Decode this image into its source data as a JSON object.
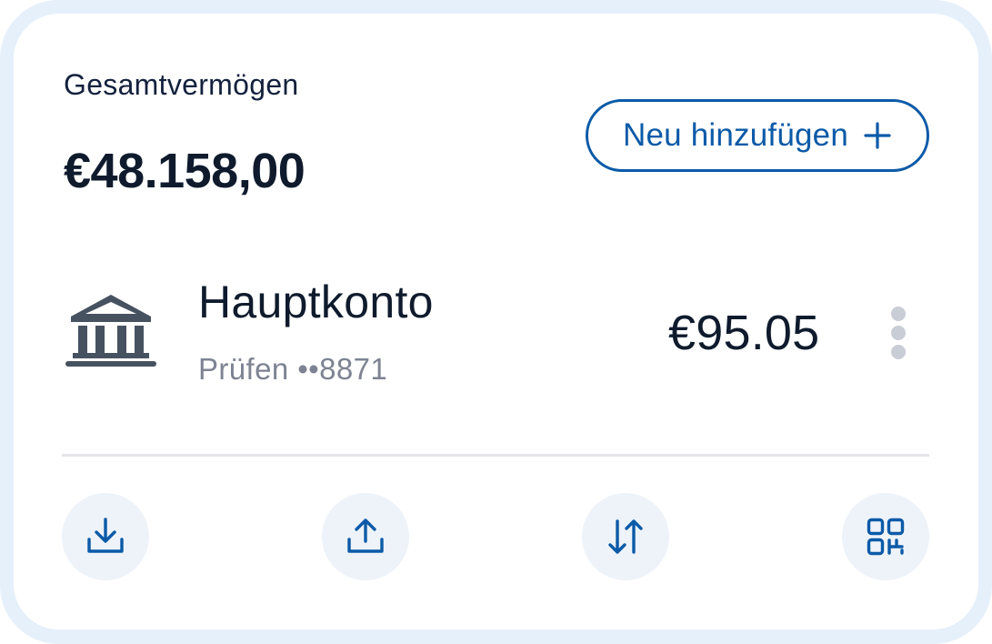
{
  "summary": {
    "total_label": "Gesamtvermögen",
    "total_value": "€48.158,00"
  },
  "add_button": {
    "label": "Neu hinzufügen",
    "icon": "plus-icon"
  },
  "account": {
    "icon": "bank-icon",
    "name": "Hauptkonto",
    "subtitle": "Prüfen ••8871",
    "balance": "€95.05",
    "menu_icon": "more-vertical-icon"
  },
  "actions": [
    {
      "icon": "download-icon"
    },
    {
      "icon": "upload-icon"
    },
    {
      "icon": "transfer-arrows-icon"
    },
    {
      "icon": "qr-code-icon"
    }
  ],
  "colors": {
    "accent": "#0b5aa8",
    "text_primary": "#0f1b2d",
    "text_secondary": "#7d8392",
    "icon_gray": "#475261",
    "action_bg": "#eef3f9",
    "frame_bg": "#e6f0fb"
  }
}
